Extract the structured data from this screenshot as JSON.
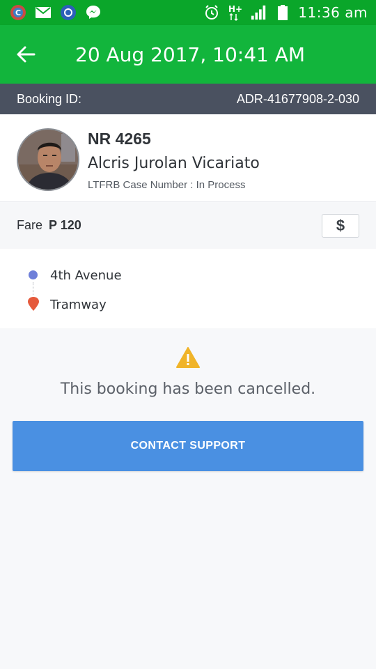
{
  "status_bar": {
    "clock": "11:36 am",
    "icons": [
      "app-icon",
      "mail-icon",
      "browser-icon",
      "messenger-icon",
      "alarm-icon",
      "network-h-plus-icon",
      "signal-icon",
      "battery-icon"
    ]
  },
  "app_bar": {
    "title": "20 Aug 2017, 10:41 AM",
    "back_icon": "arrow-left-icon",
    "color": "#12b53c"
  },
  "booking": {
    "id_label": "Booking ID:",
    "id_value": "ADR-41677908-2-030"
  },
  "driver": {
    "plate": "NR 4265",
    "name": "Alcris Jurolan Vicariato",
    "ltfrb": "LTFRB Case Number : In Process"
  },
  "fare": {
    "label": "Fare",
    "value": "P 120",
    "button_icon": "$"
  },
  "route": {
    "pickup": "4th Avenue",
    "dropoff": "Tramway"
  },
  "notice": {
    "message": "This booking has been cancelled.",
    "icon": "warning-icon",
    "icon_color": "#f0b429"
  },
  "support_button": {
    "label": "CONTACT SUPPORT",
    "color": "#4a90e2"
  }
}
